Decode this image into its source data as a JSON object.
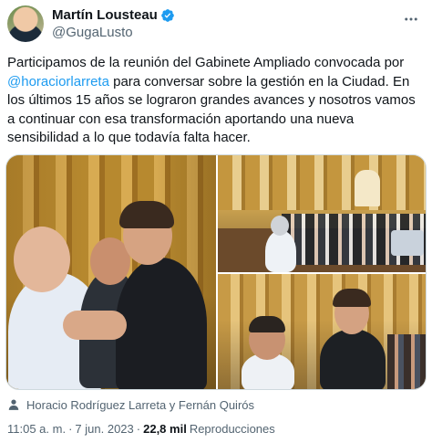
{
  "author": {
    "display_name": "Martín Lousteau",
    "handle": "@GugaLusto",
    "verified_icon": "verified-badge-icon"
  },
  "tweet": {
    "text_before_mention": "Participamos de la reunión del Gabinete Ampliado convocada por ",
    "mention": "@horaciorlarreta",
    "text_after_mention": " para conversar sobre la gestión en la Ciudad. En los últimos 15 años se lograron grandes avances y nosotros vamos a continuar con esa transformación aportando una nueva sensibilidad a lo que todavía falta hacer.",
    "photos_count": 3
  },
  "tagged": {
    "icon": "person-icon",
    "text": "Horacio Rodríguez Larreta y Fernán Quirós"
  },
  "meta": {
    "time": "11:05 a. m.",
    "separator": "·",
    "date": "7 jun. 2023",
    "views_count": "22,8 mil",
    "views_label": "Reproducciones"
  },
  "colors": {
    "accent": "#1d9bf0",
    "text": "#0f1419",
    "secondary": "#536471"
  }
}
